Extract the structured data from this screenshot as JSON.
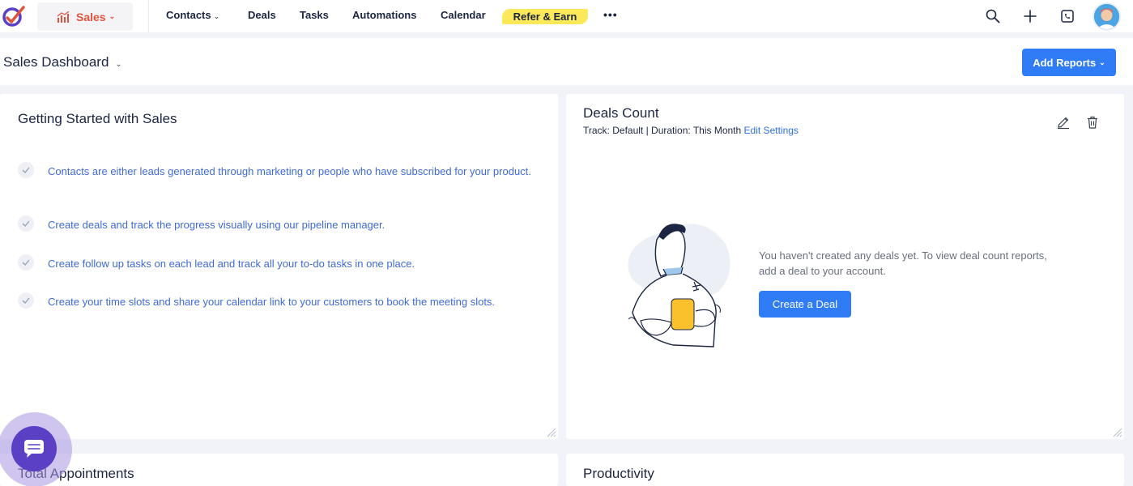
{
  "nav": {
    "module": "Sales",
    "items": [
      "Contacts",
      "Deals",
      "Tasks",
      "Automations",
      "Calendar"
    ],
    "refer": "Refer & Earn",
    "more": "•••"
  },
  "header": {
    "title": "Sales Dashboard",
    "add_reports": "Add Reports"
  },
  "getting_started": {
    "title": "Getting Started with Sales",
    "steps": [
      "Contacts are either leads generated through marketing or people who have subscribed for your product.",
      "Create deals and track the progress visually using our pipeline manager.",
      "Create follow up tasks on each lead and track all your to-do tasks in one place.",
      "Create your time slots and share your calendar link to your customers to book the meeting slots."
    ]
  },
  "deals_count": {
    "title": "Deals Count",
    "meta": "Track: Default | Duration: This Month",
    "edit_settings": "Edit Settings",
    "empty_message": "You haven't created any deals yet. To view deal count reports, add a deal to your account.",
    "create_button": "Create a Deal"
  },
  "appointments": {
    "title": "Total Appointments"
  },
  "productivity": {
    "title": "Productivity"
  },
  "colors": {
    "accent": "#2f7cf6",
    "module": "#e0533c",
    "refer_bg": "#fbe95a",
    "link": "#3f6ad8",
    "chat": "#5b3fc4"
  },
  "icons": [
    "logo-icon",
    "chart-icon",
    "search-icon",
    "plus-icon",
    "dialer-icon",
    "avatar",
    "check-icon",
    "edit-icon",
    "trash-icon",
    "resize-grip-icon",
    "chat-icon"
  ]
}
